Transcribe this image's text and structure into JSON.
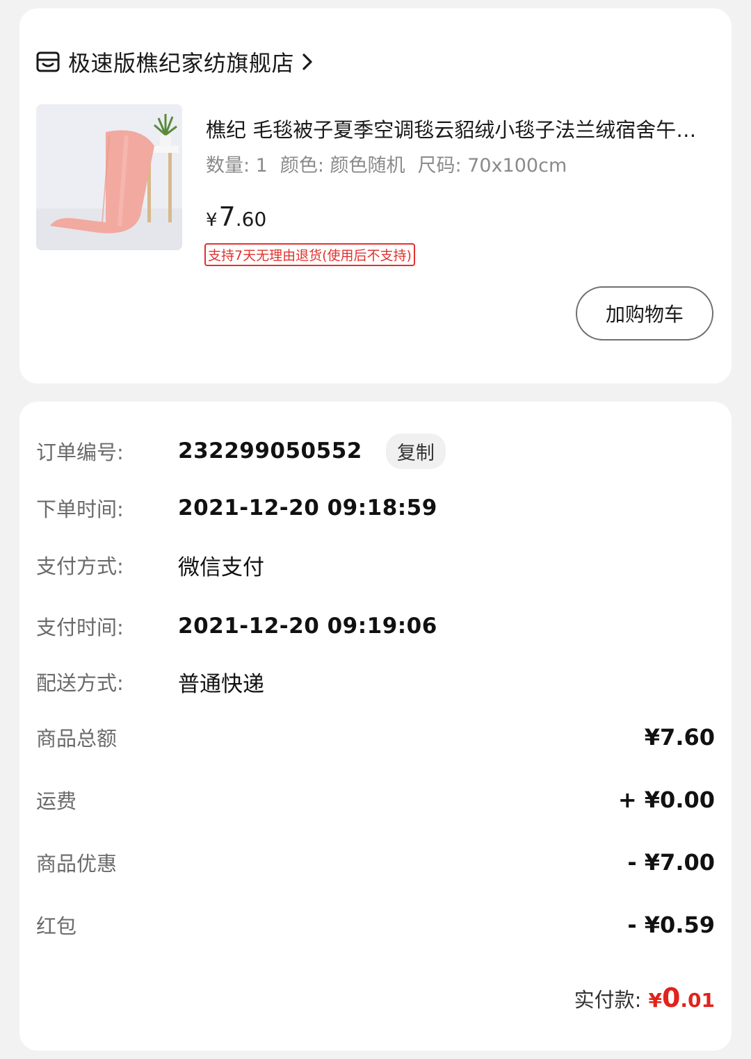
{
  "store": {
    "icon": "store-icon",
    "name": "极速版樵纪家纺旗舰店"
  },
  "product": {
    "title": "樵纪 毛毯被子夏季空调毯云貂绒小毯子法兰绒宿舍午睡盖毯",
    "quantity": "数量: 1",
    "color": "颜色: 颜色随机",
    "size": "尺码: 70x100cm",
    "price_currency": "¥",
    "price_int": "7",
    "price_dec": ".60",
    "return_policy": "支持7天无理由退货(使用后不支持)",
    "add_to_cart": "加购物车"
  },
  "order": {
    "number_label": "订单编号:",
    "number": "232299050552",
    "copy_label": "复制",
    "order_time_label": "下单时间:",
    "order_time": "2021-12-20 09:18:59",
    "payment_method_label": "支付方式:",
    "payment_method": "微信支付",
    "pay_time_label": "支付时间:",
    "pay_time": "2021-12-20 09:19:06",
    "delivery_label": "配送方式:",
    "delivery": "普通快递"
  },
  "amounts": {
    "goods_total_label": "商品总额",
    "goods_total": "¥7.60",
    "shipping_label": "运费",
    "shipping": "+ ¥0.00",
    "discount_label": "商品优惠",
    "discount": "- ¥7.00",
    "red_packet_label": "红包",
    "red_packet": "- ¥0.59",
    "paid_label": "实付款:",
    "paid_currency": "¥",
    "paid_int": "0",
    "paid_dec": ".01"
  },
  "colors": {
    "accent_red": "#e0231c",
    "page_bg": "#f2f2f2"
  }
}
